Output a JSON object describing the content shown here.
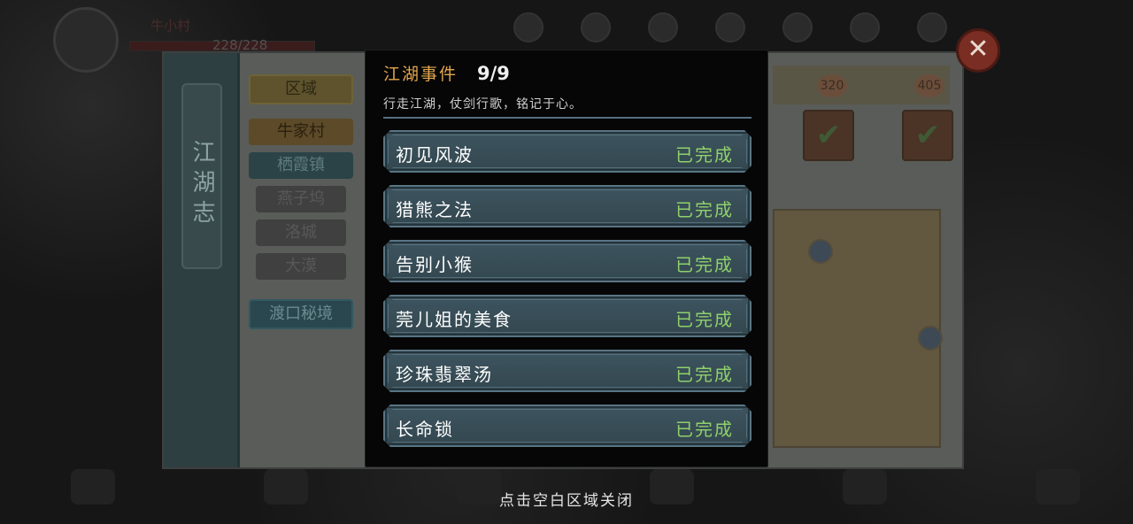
{
  "background": {
    "hud": {
      "player_name": "牛小村",
      "hp_text": "228/228"
    },
    "book": {
      "title": "江湖志",
      "left_tabs": {
        "region_label": "区域",
        "items": [
          {
            "label": "牛家村",
            "state": "gold"
          },
          {
            "label": "栖霞镇",
            "state": "teal"
          },
          {
            "label": "燕子坞",
            "state": "locked"
          },
          {
            "label": "洛城",
            "state": "locked"
          },
          {
            "label": "大漠",
            "state": "locked"
          }
        ],
        "special": "渡口秘境"
      },
      "milestones": [
        "320",
        "405"
      ],
      "rewards": [
        "✔",
        "✔"
      ]
    }
  },
  "modal": {
    "title": "江湖事件",
    "count": "9/9",
    "subtitle": "行走江湖，仗剑行歌，铭记于心。",
    "events": [
      {
        "name": "初见风波",
        "status": "已完成"
      },
      {
        "name": "猎熊之法",
        "status": "已完成"
      },
      {
        "name": "告别小猴",
        "status": "已完成"
      },
      {
        "name": "莞儿姐的美食",
        "status": "已完成"
      },
      {
        "name": "珍珠翡翠汤",
        "status": "已完成"
      },
      {
        "name": "长命锁",
        "status": "已完成"
      }
    ]
  },
  "close_icon": "close-x-icon",
  "hint": "点击空白区域关闭",
  "colors": {
    "title_gold": "#e2a64e",
    "status_green": "#8fd16b",
    "row_fill": "#3d545f",
    "close_red": "#7a2d22"
  }
}
